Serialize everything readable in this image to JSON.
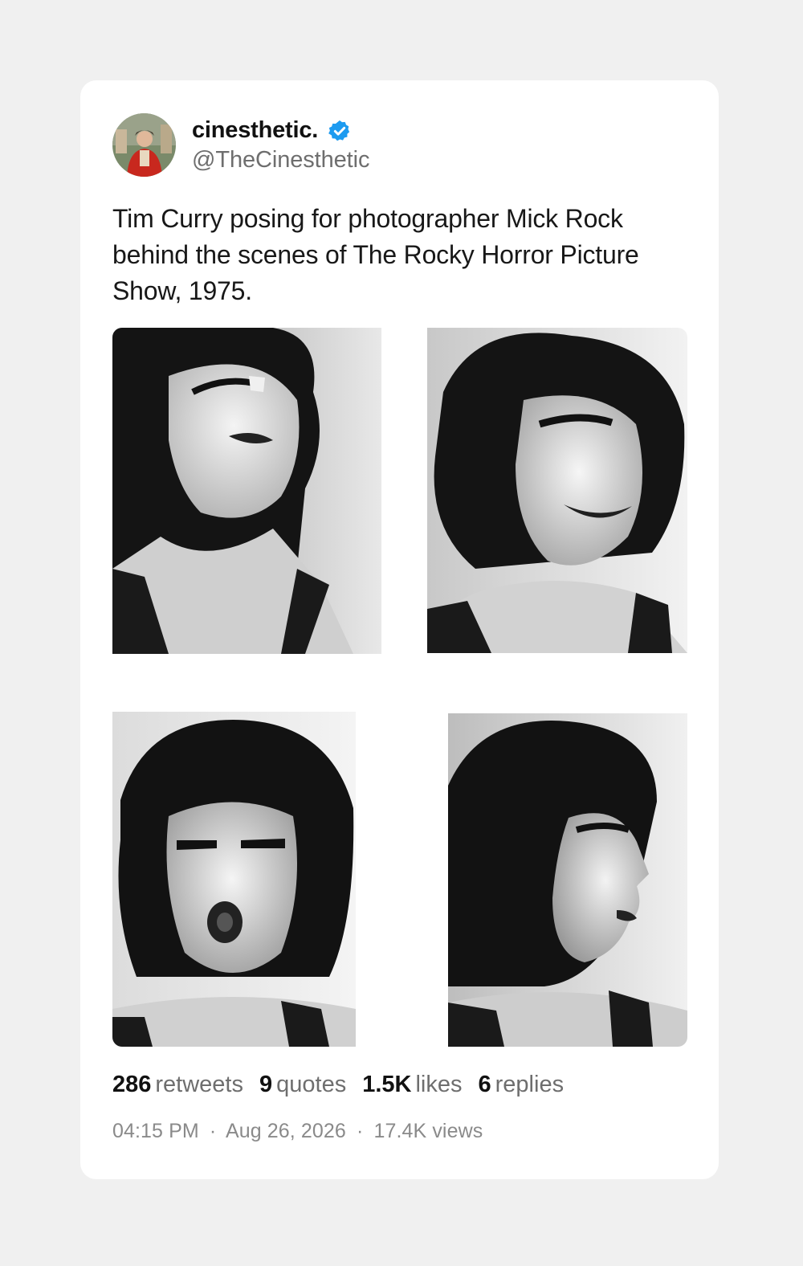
{
  "author": {
    "display_name": "cinesthetic.",
    "handle": "@TheCinesthetic",
    "verified": true,
    "verified_icon": "verified-badge-icon",
    "verified_color": "#1d9bf0"
  },
  "post": {
    "text": "Tim Curry posing for photographer Mick Rock behind the scenes of The Rocky Horror Picture Show, 1975.",
    "media_count": 4
  },
  "stats": [
    {
      "value": "286",
      "label": "retweets"
    },
    {
      "value": "9",
      "label": "quotes"
    },
    {
      "value": "1.5K",
      "label": "likes"
    },
    {
      "value": "6",
      "label": "replies"
    }
  ],
  "meta": {
    "time": "04:15 PM",
    "date": "Aug 26, 2026",
    "views": "17.4K views",
    "separator": "·"
  }
}
